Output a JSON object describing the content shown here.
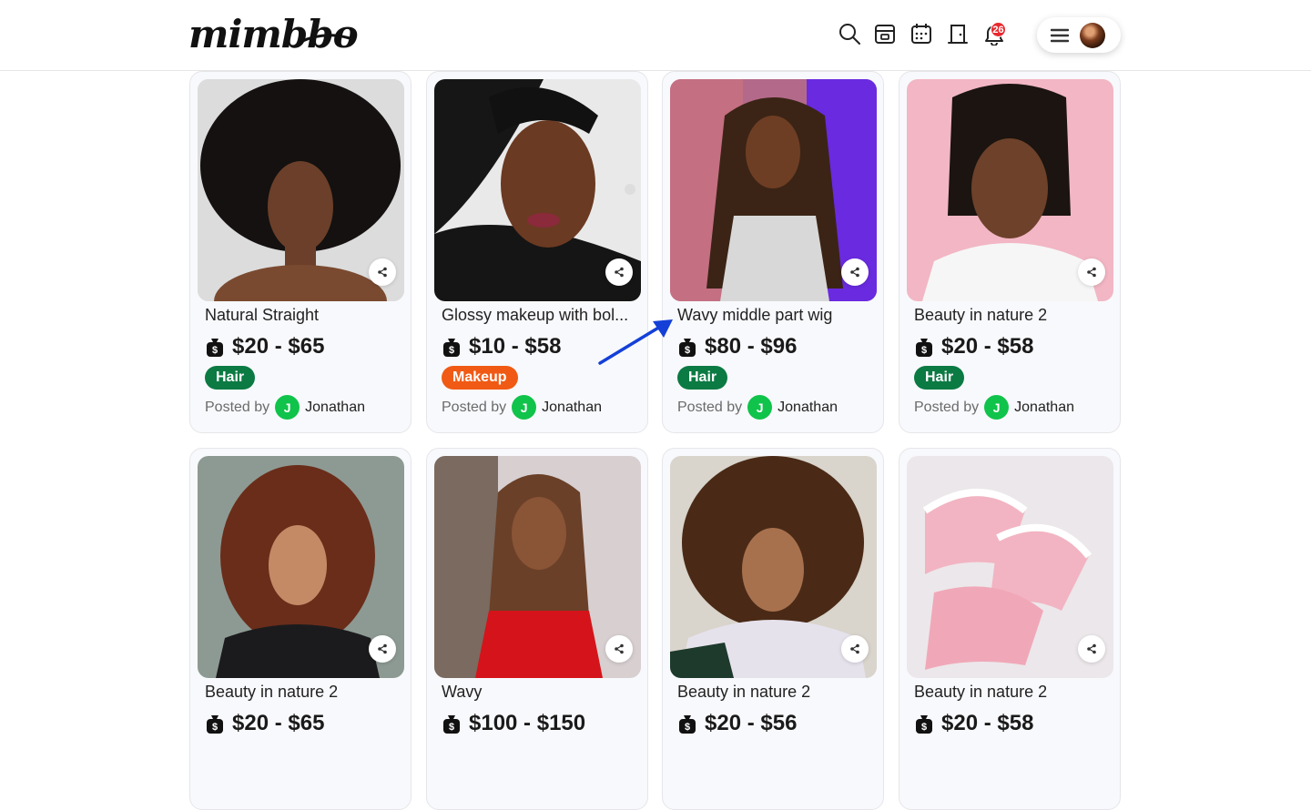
{
  "header": {
    "logo": "mimbbo",
    "notification_count": "26",
    "icons": [
      "search-icon",
      "store-icon",
      "calendar-icon",
      "door-icon",
      "bell-icon",
      "hamburger-menu-icon"
    ]
  },
  "cards": [
    {
      "title": "Natural Straight",
      "price": "$20 - $65",
      "category": "Hair",
      "category_color": "#0b7a43",
      "posted_by": "Posted by",
      "author_initial": "J",
      "author": "Jonathan",
      "image": "afro-portrait-photo"
    },
    {
      "title": "Glossy makeup with bol...",
      "price": "$10 - $58",
      "category": "Makeup",
      "category_color": "#f05a14",
      "posted_by": "Posted by",
      "author_initial": "J",
      "author": "Jonathan",
      "image": "glossy-makeup-photo"
    },
    {
      "title": "Wavy middle part wig",
      "price": "$80 - $96",
      "category": "Hair",
      "category_color": "#0b7a43",
      "posted_by": "Posted by",
      "author_initial": "J",
      "author": "Jonathan",
      "image": "wavy-wig-photo"
    },
    {
      "title": "Beauty in nature 2",
      "price": "$20 - $58",
      "category": "Hair",
      "category_color": "#0b7a43",
      "posted_by": "Posted by",
      "author_initial": "J",
      "author": "Jonathan",
      "image": "braided-ponytail-photo"
    },
    {
      "title": "Beauty in nature 2",
      "price": "$20 - $65",
      "image": "curly-bangs-photo"
    },
    {
      "title": "Wavy",
      "price": "$100 - $150",
      "image": "highlighted-waves-photo"
    },
    {
      "title": "Beauty in nature 2",
      "price": "$20 - $56",
      "image": "curly-hair-portrait-photo"
    },
    {
      "title": "Beauty in nature 2",
      "price": "$20 - $58",
      "image": "pink-nails-photo"
    }
  ],
  "colors": {
    "accent_green": "#10c34b",
    "hair_tag": "#0b7a43",
    "makeup_tag": "#f05a14",
    "badge_red": "#e8282e",
    "arrow_blue": "#1440d8"
  }
}
